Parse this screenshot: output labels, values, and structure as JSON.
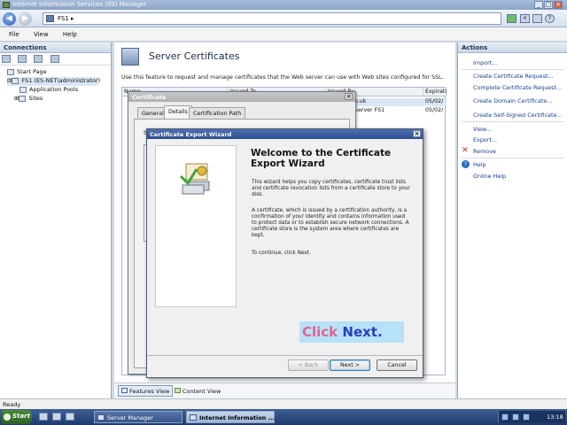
{
  "window": {
    "title": "Internet Information Services (IIS) Manager"
  },
  "address": {
    "path": "FS1"
  },
  "menu": [
    "File",
    "View",
    "Help"
  ],
  "connections": {
    "header": "Connections",
    "tree": [
      "Start Page",
      "FS1 (ES-NET\\administrator)",
      "Application Pools",
      "Sites"
    ]
  },
  "center": {
    "title": "Server Certificates",
    "description": "Use this feature to request and manage certificates that the Web server can use with Web sites configured for SSL.",
    "columns": [
      "Name",
      "Issued To",
      "Issued By",
      "Expirati"
    ],
    "rows": [
      {
        "issued_by": "o.uk",
        "expiry": "05/02/"
      },
      {
        "issued_by": "Server FS1",
        "expiry": "05/02/"
      }
    ],
    "view_features": "Features View",
    "view_content": "Content View"
  },
  "actions": {
    "header": "Actions",
    "items": [
      "Import...",
      "Create Certificate Request...",
      "Complete Certificate Request...",
      "Create Domain Certificate...",
      "Create Self-Signed Certificate...",
      "View...",
      "Export...",
      "Remove",
      "Help",
      "Online Help"
    ]
  },
  "status": {
    "text": "Ready"
  },
  "taskbar": {
    "start": "Start",
    "tasks": [
      "Server Manager",
      "Internet Information ..."
    ],
    "clock": "13:18"
  },
  "certificate_dialog": {
    "title": "Certificate",
    "tabs": [
      "General",
      "Details",
      "Certification Path"
    ],
    "show_prefix": "Sh"
  },
  "wizard": {
    "title": "Certificate Export Wizard",
    "heading": "Welcome to the Certificate Export Wizard",
    "para1": "This wizard helps you copy certificates, certificate trust lists and certificate revocation lists from a certificate store to your disk.",
    "para2": "A certificate, which is issued by a certification authority, is a confirmation of your identity and contains information used to protect data or to establish secure network connections. A certificate store is the system area where certificates are kept.",
    "para3": "To continue, click Next.",
    "back": "< Back",
    "next": "Next >",
    "cancel": "Cancel"
  },
  "callout": {
    "click": "Click",
    "next": "Next."
  },
  "colors": {
    "callout_bg": "#b6e1f7",
    "callout_click": "#e8618c",
    "callout_next": "#2b3fb8",
    "link": "#1a3f8a"
  }
}
